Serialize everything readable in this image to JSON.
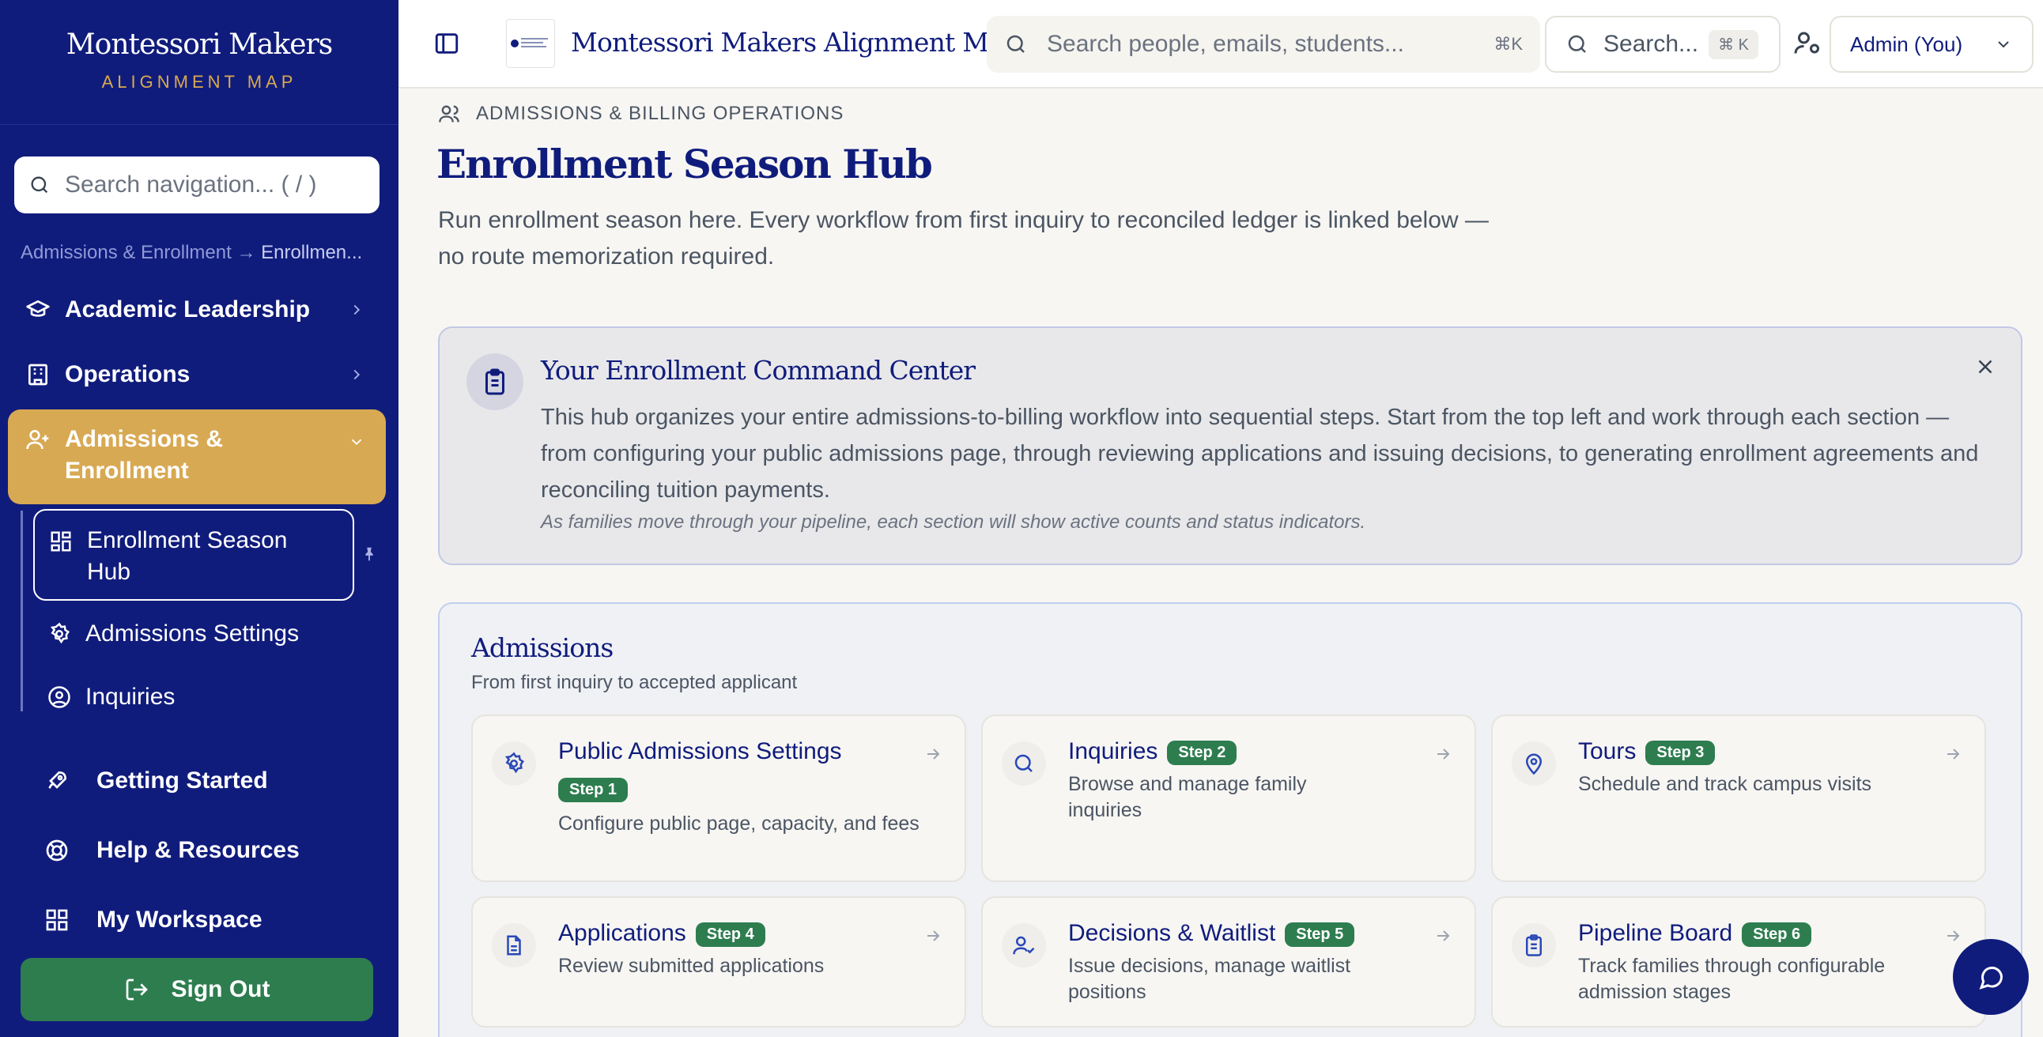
{
  "brand": {
    "name": "Montessori Makers",
    "subtitle": "ALIGNMENT MAP"
  },
  "sidebar": {
    "search_placeholder": "Search navigation... ( / )",
    "breadcrumb_parent": "Admissions & Enrollment",
    "breadcrumb_arrow": "→",
    "breadcrumb_current": "Enrollmen...",
    "groups": [
      {
        "label": "Academic Leadership",
        "icon": "graduation-cap-icon"
      },
      {
        "label": "Operations",
        "icon": "building-icon"
      },
      {
        "label": "Admissions &",
        "label2": "Enrollment",
        "icon": "user-plus-icon",
        "active": true
      }
    ],
    "subitems": [
      {
        "label": "Enrollment Season",
        "label2": "Hub",
        "icon": "grid-icon",
        "active": true
      },
      {
        "label": "Admissions Settings",
        "icon": "gear-icon"
      },
      {
        "label": "Inquiries",
        "icon": "user-circle-icon"
      }
    ],
    "bottom": [
      {
        "label": "Getting Started",
        "icon": "rocket-icon"
      },
      {
        "label": "Help & Resources",
        "icon": "lifebuoy-icon"
      },
      {
        "label": "My Workspace",
        "icon": "grid-icon"
      }
    ],
    "signout_label": "Sign Out"
  },
  "topbar": {
    "title": "Montessori Makers Alignment Map",
    "search_placeholder": "Search people, emails, students...",
    "search_kbd": "⌘K",
    "search2_label": "Search...",
    "search2_kbd": "⌘ K",
    "role_label": "Admin (You)"
  },
  "page": {
    "section_label": "ADMISSIONS & BILLING OPERATIONS",
    "title": "Enrollment Season Hub",
    "description": "Run enrollment season here. Every workflow from first inquiry to reconciled ledger is linked below — no route memorization required."
  },
  "callout": {
    "title": "Your Enrollment Command Center",
    "body": "This hub organizes your entire admissions-to-billing workflow into sequential steps. Start from the top left and work through each section — from configuring your public admissions page, through reviewing applications and issuing decisions, to generating enrollment agreements and reconciling tuition payments.",
    "note": "As families move through your pipeline, each section will show active counts and status indicators."
  },
  "admissions": {
    "title": "Admissions",
    "subtitle": "From first inquiry to accepted applicant",
    "cards": [
      {
        "title": "Public Admissions Settings",
        "step": "Step 1",
        "desc": "Configure public page, capacity, and fees",
        "icon": "gear-icon"
      },
      {
        "title": "Inquiries",
        "step": "Step 2",
        "desc": "Browse and manage family inquiries",
        "icon": "search-icon"
      },
      {
        "title": "Tours",
        "step": "Step 3",
        "desc": "Schedule and track campus visits",
        "icon": "map-pin-icon"
      },
      {
        "title": "Applications",
        "step": "Step 4",
        "desc": "Review submitted applications",
        "icon": "document-icon"
      },
      {
        "title": "Decisions & Waitlist",
        "step": "Step 5",
        "desc": "Issue decisions, manage waitlist positions",
        "icon": "user-check-icon"
      },
      {
        "title": "Pipeline Board",
        "step": "Step 6",
        "desc": "Track families through configurable admission stages",
        "icon": "clipboard-icon"
      }
    ]
  },
  "colors": {
    "sidebar_bg": "#101c7c",
    "accent_gold": "#d8a953",
    "step_green": "#2e7d4f",
    "signout_green": "#2e7d4f"
  }
}
